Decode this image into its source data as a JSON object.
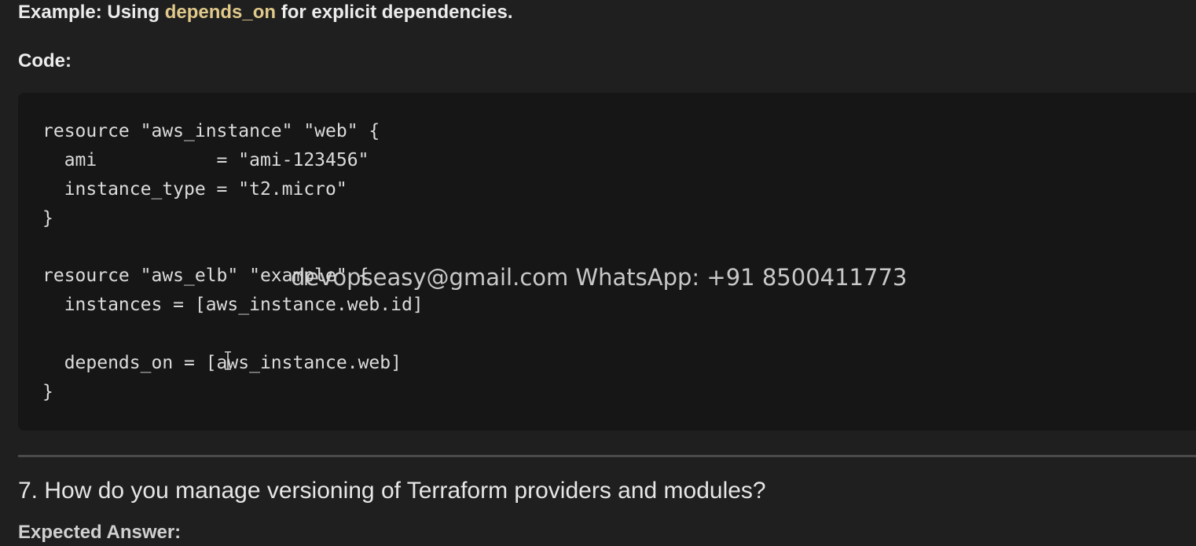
{
  "example": {
    "prefix": "Example: Using ",
    "keyword": "depends_on",
    "suffix": " for explicit dependencies."
  },
  "code_label": "Code:",
  "code_lines": [
    "resource \"aws_instance\" \"web\" {",
    "  ami           = \"ami-123456\"",
    "  instance_type = \"t2.micro\"",
    "}",
    "",
    "resource \"aws_elb\" \"example\" {",
    "  instances = [aws_instance.web.id]",
    "",
    "  depends_on = [aws_instance.web]",
    "}"
  ],
  "watermark": "devopseasy@gmail.com WhatsApp: +91 8500411773",
  "question": "7. How do you manage versioning of Terraform providers and modules?",
  "expected_answer_label": "Expected Answer:",
  "icons": {
    "cursor": "text-cursor-icon"
  },
  "colors": {
    "background": "#1f1f1f",
    "code_background": "#161616",
    "keyword": "#e0c98a"
  }
}
